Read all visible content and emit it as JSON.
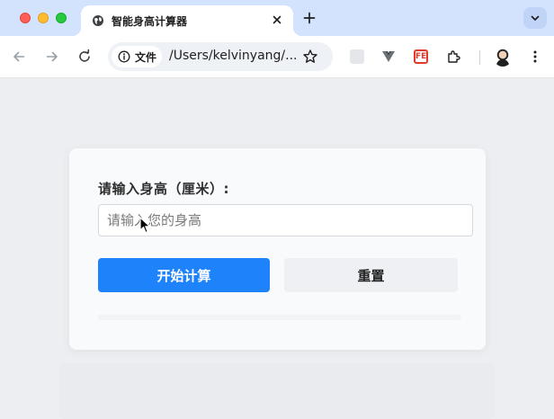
{
  "browser": {
    "tab": {
      "title": "智能身高计算器",
      "favicon": "globe-icon"
    },
    "toolbar": {
      "site_chip_label": "文件",
      "url": "/Users/kelvinyang/...",
      "extension_fe_label": "FE"
    }
  },
  "page": {
    "form": {
      "height_label": "请输入身高（厘米）:",
      "height_input_placeholder": "请输入您的身高",
      "height_input_value": ""
    },
    "buttons": {
      "calculate_label": "开始计算",
      "reset_label": "重置"
    }
  },
  "colors": {
    "tabstrip_bg": "#d3e3fd",
    "primary_button": "#1e82fa",
    "reset_button": "#eef0f3",
    "page_bg": "#eceef1",
    "card_bg": "#f8fafc"
  }
}
